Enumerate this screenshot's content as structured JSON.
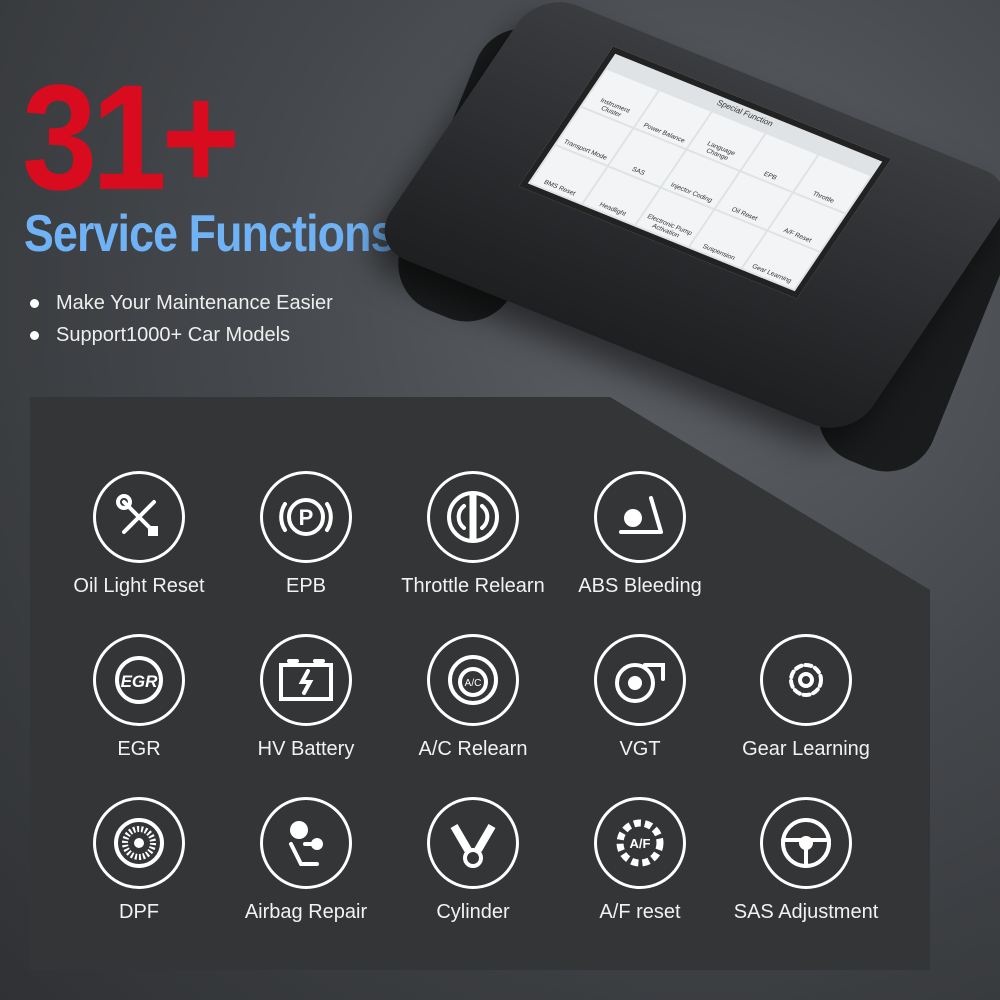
{
  "headline": {
    "count": "31+",
    "title": "Service Functions",
    "bullets": [
      "Make Your Maintenance Easier",
      "Support1000+ Car Models"
    ]
  },
  "colors": {
    "count": "#d90b1f",
    "title": "#6fb2f5",
    "panel": "#343537"
  },
  "device_screen": {
    "header": "Special Function",
    "tiles": [
      "Instrument Cluster",
      "Power Balance",
      "Language Change",
      "EPB",
      "Throttle",
      "Transport Mode",
      "SAS",
      "Injector Coding",
      "Oil Reset",
      "A/F Reset",
      "BMS Reset",
      "Headlight",
      "Electronic Pump Activation",
      "Suspension",
      "Gear Learning"
    ]
  },
  "functions": [
    {
      "label": "Oil Light Reset",
      "icon": "wrench-screwdriver-icon"
    },
    {
      "label": "EPB",
      "icon": "parking-brake-icon"
    },
    {
      "label": "Throttle Relearn",
      "icon": "throttle-icon"
    },
    {
      "label": "ABS Bleeding",
      "icon": "abs-bleeding-icon"
    },
    {
      "label": "EGR",
      "icon": "egr-icon"
    },
    {
      "label": "HV Battery",
      "icon": "battery-icon"
    },
    {
      "label": "A/C Relearn",
      "icon": "ac-icon"
    },
    {
      "label": "VGT",
      "icon": "turbo-icon"
    },
    {
      "label": "Gear Learning",
      "icon": "gear-icon"
    },
    {
      "label": "DPF",
      "icon": "dpf-filter-icon"
    },
    {
      "label": "Airbag Repair",
      "icon": "airbag-icon"
    },
    {
      "label": "Cylinder",
      "icon": "cylinder-piston-icon"
    },
    {
      "label": "A/F reset",
      "icon": "af-gear-icon"
    },
    {
      "label": "SAS Adjustment",
      "icon": "steering-wheel-icon"
    }
  ]
}
